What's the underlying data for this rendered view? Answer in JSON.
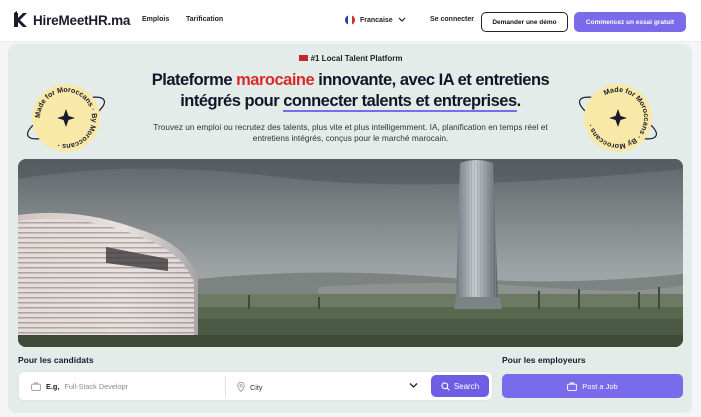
{
  "header": {
    "brand": "HireMeetHR.ma",
    "nav": [
      {
        "label": "Emplois"
      },
      {
        "label": "Tarification"
      }
    ],
    "language": "Francaise",
    "login": "Se connecter",
    "demo": "Demander une démo",
    "trial": "Commencez un essai gratuit"
  },
  "hero": {
    "badge": "#1 Local Talent Platform",
    "headline_a": "Plateforme ",
    "headline_red": "marocaine",
    "headline_b": " innovante, avec IA et entretiens",
    "headline_c": "intégrés pour ",
    "headline_ul": "connecter talents et entreprises",
    "headline_d": ".",
    "subtitle": "Trouvez un emploi ou recrutez des talents, plus vite et plus intelligemment. IA, planification en temps réel et entretiens intégrés, conçus pour le marché marocain.",
    "seal_text": "Made for Moroccans · By Moroccans ·"
  },
  "search": {
    "candidates_label": "Pour les candidats",
    "job_prefix": "E.g,",
    "job_placeholder": "Full-Stack Developr",
    "city_placeholder": "City",
    "search_label": "Search",
    "employers_label": "Pour les employeurs",
    "post_label": "Post a Job"
  },
  "colors": {
    "accent": "#7a6bea",
    "brand_red": "#d92b2b",
    "hero_bg": "#e3ece8"
  }
}
